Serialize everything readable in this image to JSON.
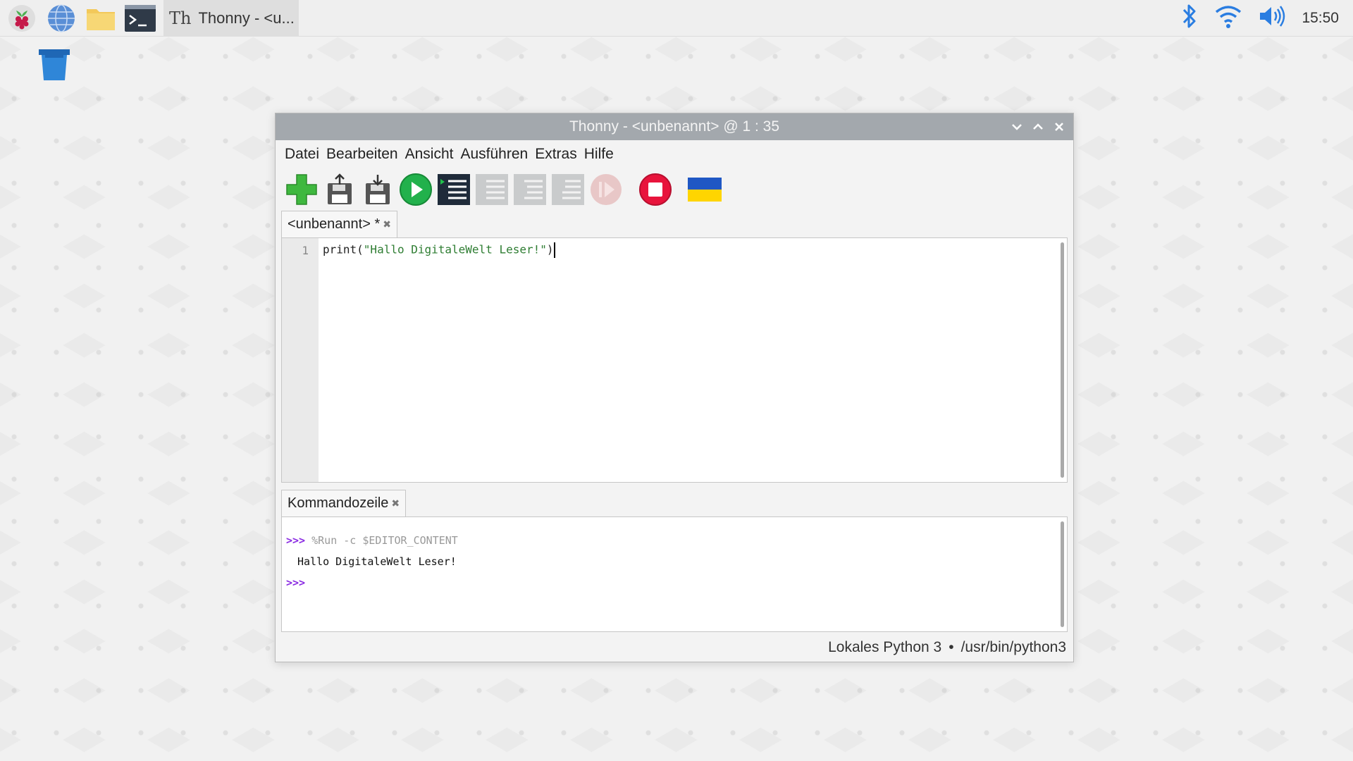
{
  "taskbar": {
    "launchers": [
      "raspberry-menu",
      "web-browser",
      "file-manager",
      "terminal"
    ],
    "task_title": "Thonny - <u...",
    "tray_icons": [
      "bluetooth-icon",
      "wifi-icon",
      "volume-icon"
    ],
    "clock": "15:50"
  },
  "window": {
    "title": "Thonny - <unbenannt> @ 1 : 35",
    "menu": [
      "Datei",
      "Bearbeiten",
      "Ansicht",
      "Ausführen",
      "Extras",
      "Hilfe"
    ],
    "toolbar": [
      "new",
      "load",
      "save",
      "run",
      "debug",
      "step-over",
      "step-into",
      "step-out",
      "resume",
      "stop",
      "ukraine-flag"
    ],
    "editor": {
      "tab_label": "<unbenannt> *",
      "line_number": "1",
      "code_fn": "print(",
      "code_str": "\"Hallo DigitaleWelt Leser!\"",
      "code_end": ")"
    },
    "shell": {
      "tab_label": "Kommandozeile",
      "prompt": ">>>",
      "command": "%Run -c $EDITOR_CONTENT",
      "output": "Hallo DigitaleWelt Leser!"
    },
    "status": {
      "interpreter": "Lokales Python 3",
      "separator": "•",
      "path": "/usr/bin/python3"
    }
  },
  "colors": {
    "titlebar": "#a3a8ad",
    "run_green": "#22b14c",
    "stop_red": "#e8143c",
    "prompt_purple": "#8a2be2",
    "string_green": "#2e7d32"
  }
}
